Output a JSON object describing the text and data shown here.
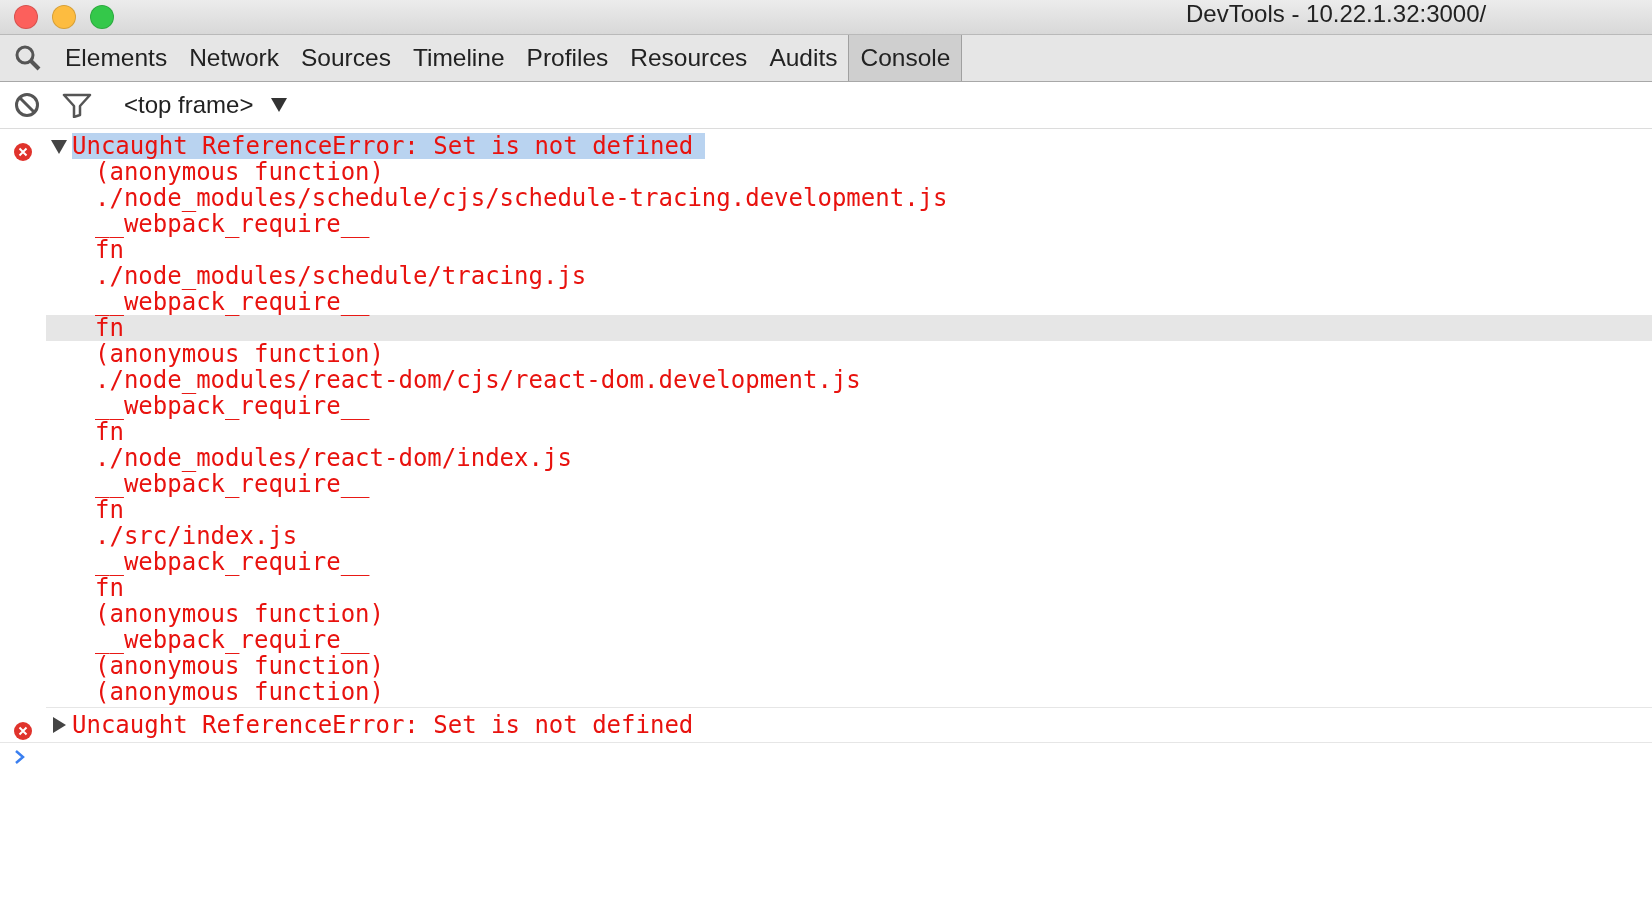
{
  "window": {
    "title": "DevTools - 10.22.1.32:3000/"
  },
  "tabs": [
    {
      "label": "Elements",
      "selected": false
    },
    {
      "label": "Network",
      "selected": false
    },
    {
      "label": "Sources",
      "selected": false
    },
    {
      "label": "Timeline",
      "selected": false
    },
    {
      "label": "Profiles",
      "selected": false
    },
    {
      "label": "Resources",
      "selected": false
    },
    {
      "label": "Audits",
      "selected": false
    },
    {
      "label": "Console",
      "selected": true
    }
  ],
  "toolbar": {
    "frame_selector": "<top frame>"
  },
  "messages": [
    {
      "text": "Uncaught ReferenceError: Set is not defined",
      "expanded": true,
      "selected": true,
      "stack": [
        {
          "text": "(anonymous function)",
          "hovered": false
        },
        {
          "text": "./node_modules/schedule/cjs/schedule-tracing.development.js",
          "hovered": false
        },
        {
          "text": "__webpack_require__",
          "hovered": false
        },
        {
          "text": "fn",
          "hovered": false
        },
        {
          "text": "./node_modules/schedule/tracing.js",
          "hovered": false
        },
        {
          "text": "__webpack_require__",
          "hovered": false
        },
        {
          "text": "fn",
          "hovered": true
        },
        {
          "text": "(anonymous function)",
          "hovered": false
        },
        {
          "text": "./node_modules/react-dom/cjs/react-dom.development.js",
          "hovered": false
        },
        {
          "text": "__webpack_require__",
          "hovered": false
        },
        {
          "text": "fn",
          "hovered": false
        },
        {
          "text": "./node_modules/react-dom/index.js",
          "hovered": false
        },
        {
          "text": "__webpack_require__",
          "hovered": false
        },
        {
          "text": "fn",
          "hovered": false
        },
        {
          "text": "./src/index.js",
          "hovered": false
        },
        {
          "text": "__webpack_require__",
          "hovered": false
        },
        {
          "text": "fn",
          "hovered": false
        },
        {
          "text": "(anonymous function)",
          "hovered": false
        },
        {
          "text": "__webpack_require__",
          "hovered": false
        },
        {
          "text": "(anonymous function)",
          "hovered": false
        },
        {
          "text": "(anonymous function)",
          "hovered": false
        }
      ]
    },
    {
      "text": "Uncaught ReferenceError: Set is not defined",
      "expanded": false,
      "selected": false
    }
  ]
}
